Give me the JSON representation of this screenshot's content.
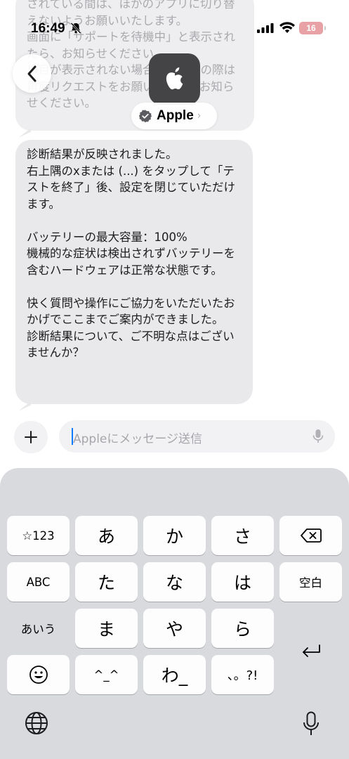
{
  "status_bar": {
    "time": "16:49",
    "battery": "16"
  },
  "header": {
    "business_name": "Apple"
  },
  "messages": {
    "previous": "されている間は、ほかのアプリに切り替えないようお願いいたします。\n画面に「サポートを待機中」と表示されたら、お知らせください。\n項目が表示されない場合やお困りの際は再度リクエストをお願いします。お知らせください。",
    "latest": "診断結果が反映されました。\n右上隅のxまたは (...) をタップして「テストを終了」後、設定を閉じていただけます。\n\nバッテリーの最大容量：100%\n機械的な症状は検出されずバッテリーを含むハードウェアは正常な状態です。\n\n快く質問や操作にご協力をいただいたおかげでここまでご案内ができました。\n診断結果について、ご不明な点はございませんか？"
  },
  "composer": {
    "placeholder": "Appleにメッセージ送信"
  },
  "keyboard": {
    "row1": [
      "☆123",
      "あ",
      "か",
      "さ"
    ],
    "row2": [
      "ABC",
      "た",
      "な",
      "は",
      "空白"
    ],
    "row3": [
      "あいう",
      "ま",
      "や",
      "ら"
    ],
    "row4": [
      "^_^",
      "わ_",
      "、。?!"
    ]
  },
  "colors": {
    "bubble": "#e9e9eb",
    "keyboard": "#d9dade",
    "caret": "#0a7aff",
    "battery": "#e8a2a5"
  }
}
